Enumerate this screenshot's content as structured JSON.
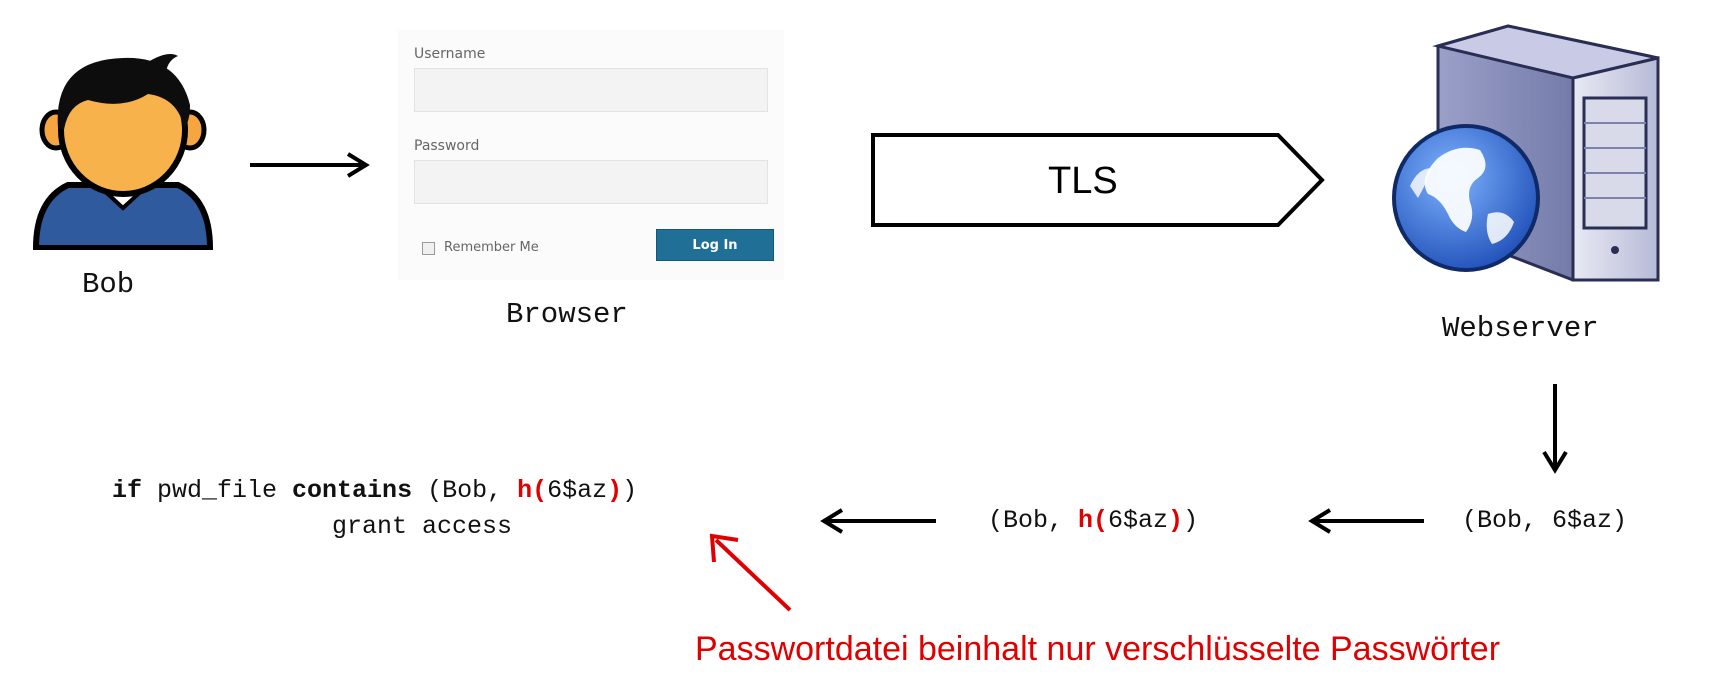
{
  "actors": {
    "bob_label": "Bob",
    "browser_label": "Browser",
    "webserver_label": "Webserver"
  },
  "login_form": {
    "username_label": "Username",
    "password_label": "Password",
    "remember_label": "Remember Me",
    "login_button": "Log In"
  },
  "channel": {
    "label": "TLS"
  },
  "flow": {
    "submitted_open": "(Bob, ",
    "submitted_password": "6$az",
    "submitted_close": ")",
    "hashed_open": "(Bob, ",
    "hash_fn": "h(",
    "hash_arg": "6$az",
    "hash_close": ")",
    "hashed_close": ")"
  },
  "check": {
    "kw_if": "if",
    "subject": " pwd_file ",
    "kw_contains": "contains",
    "tuple_open": " (Bob, ",
    "hash_fn": "h(",
    "hash_arg": "6$az",
    "hash_close": ")",
    "tuple_close": ")",
    "result": "grant access"
  },
  "note": {
    "text": "Passwortdatei beinhalt nur verschlüsselte Passwörter",
    "color": "#e00000"
  },
  "icons": [
    "user-icon",
    "web-server-icon",
    "globe-icon"
  ]
}
